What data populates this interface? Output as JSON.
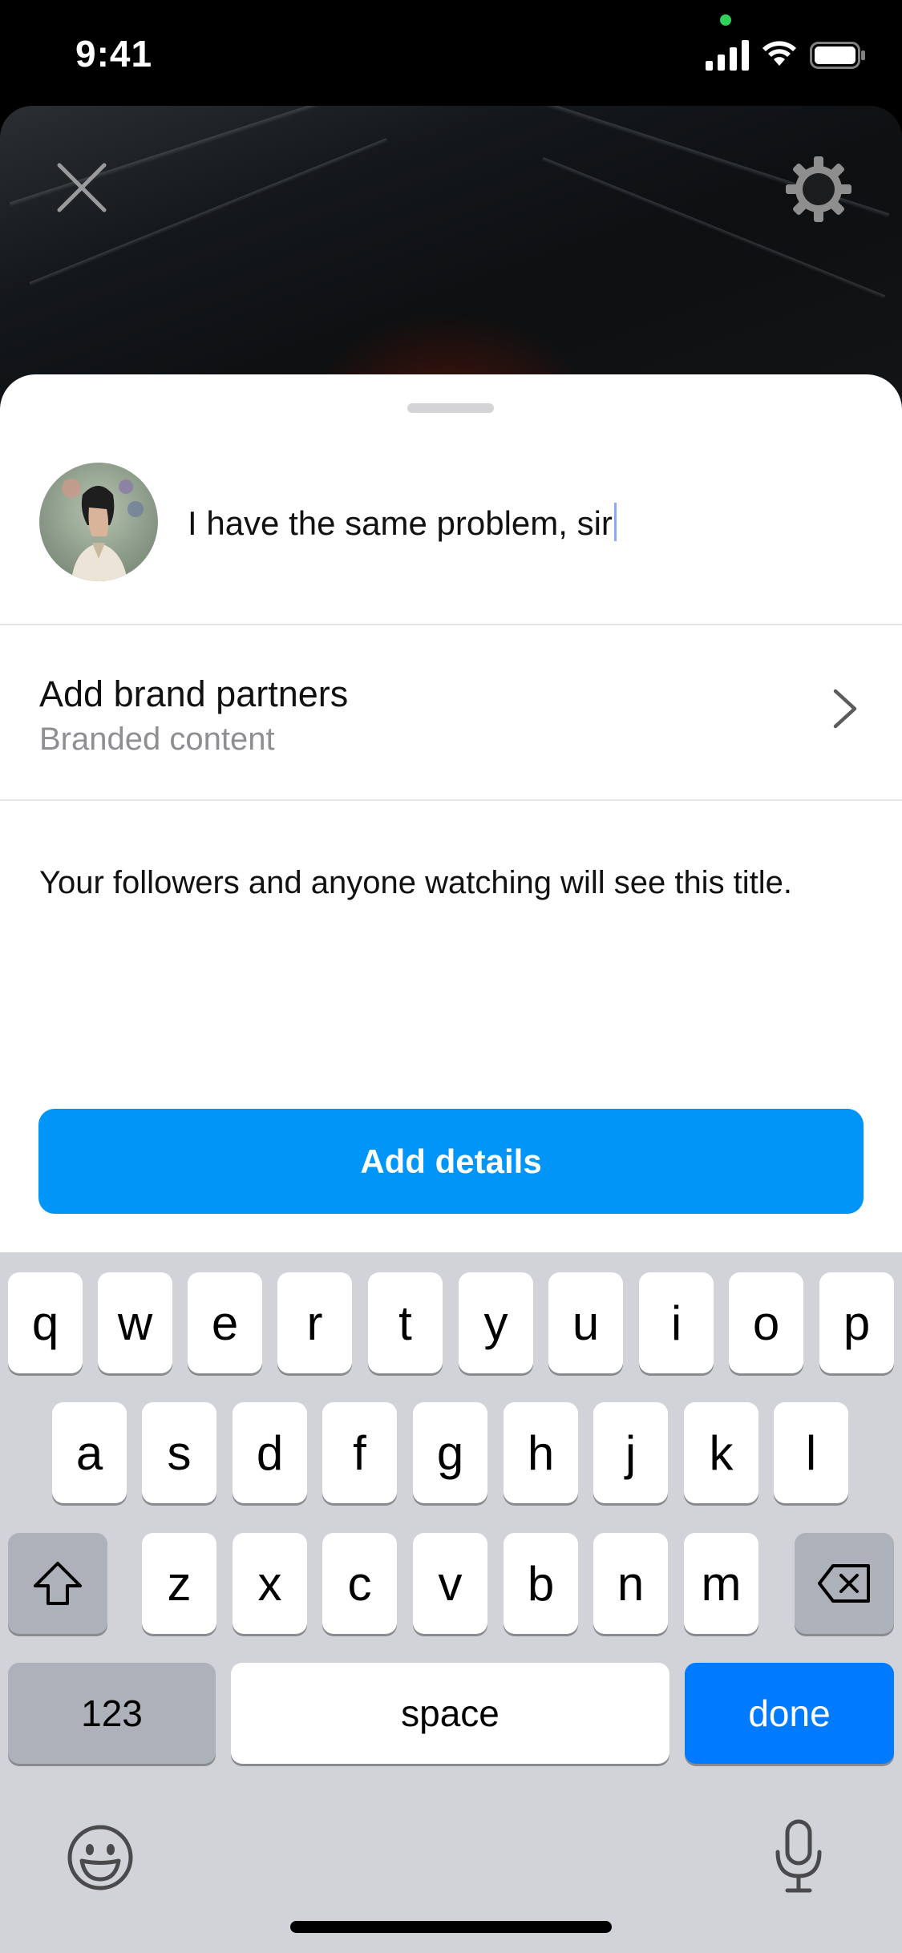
{
  "status_bar": {
    "time": "9:41"
  },
  "top_controls": {
    "close_icon": "close-icon",
    "settings_icon": "gear-icon"
  },
  "sheet": {
    "caption_value": "I have the same problem, sir",
    "brand_row": {
      "title": "Add brand partners",
      "subtitle": "Branded content"
    },
    "info_text": "Your followers and anyone watching will see this title.",
    "button_label": "Add details",
    "accent_color": "#0095f6"
  },
  "keyboard": {
    "row1": [
      "q",
      "w",
      "e",
      "r",
      "t",
      "y",
      "u",
      "i",
      "o",
      "p"
    ],
    "row2": [
      "a",
      "s",
      "d",
      "f",
      "g",
      "h",
      "j",
      "k",
      "l"
    ],
    "row3": [
      "z",
      "x",
      "c",
      "v",
      "b",
      "n",
      "m"
    ],
    "numbers_label": "123",
    "space_label": "space",
    "done_label": "done"
  }
}
